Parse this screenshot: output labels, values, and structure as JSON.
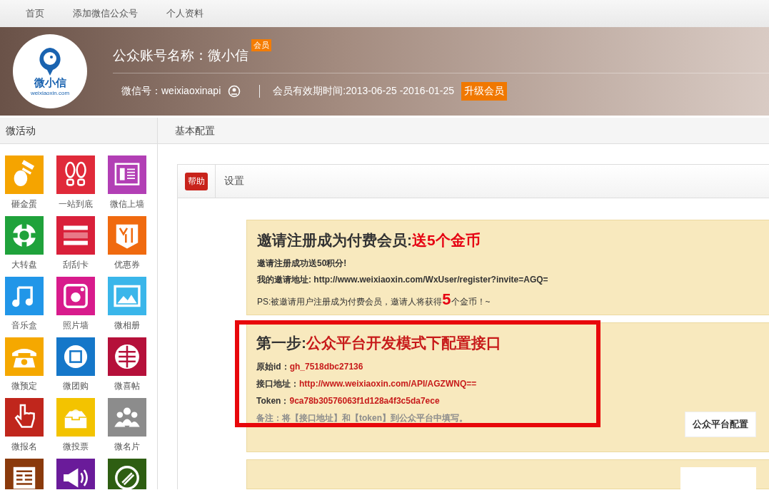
{
  "nav": [
    {
      "label": "首页"
    },
    {
      "label": "添加微信公众号"
    },
    {
      "label": "个人资料"
    }
  ],
  "header": {
    "logo_text": "微小信",
    "logo_domain": "weixiaoxin.com",
    "account_name": "公众账号名称：微小信",
    "badge": "会员",
    "wechat_id": "微信号：weixiaoxinapi",
    "validity": "会员有效期时间:2013-06-25 -2016-01-25",
    "upgrade_button": "升级会员"
  },
  "sidebar": {
    "title": "微活动",
    "tiles": [
      {
        "label": "砸金蛋",
        "color": "#f5a400"
      },
      {
        "label": "一站到底",
        "color": "#e02a3a"
      },
      {
        "label": "微信上墙",
        "color": "#b23fb5"
      },
      {
        "label": "大转盘",
        "color": "#1fa23b"
      },
      {
        "label": "刮刮卡",
        "color": "#d9203a"
      },
      {
        "label": "优惠券",
        "color": "#f06a0f"
      },
      {
        "label": "音乐盒",
        "color": "#2196e8"
      },
      {
        "label": "照片墙",
        "color": "#d81b8c"
      },
      {
        "label": "微相册",
        "color": "#3ab6ea"
      },
      {
        "label": "微预定",
        "color": "#f5a800"
      },
      {
        "label": "微团购",
        "color": "#1577c9"
      },
      {
        "label": "微喜帖",
        "color": "#b5103a"
      },
      {
        "label": "微报名",
        "color": "#c0261c"
      },
      {
        "label": "微投票",
        "color": "#f3c300"
      },
      {
        "label": "微名片",
        "color": "#8c8c8c"
      },
      {
        "color": "#8a3a0c"
      },
      {
        "color": "#6a1b9a"
      },
      {
        "color": "#2e5e12"
      }
    ]
  },
  "main": {
    "title": "基本配置",
    "panel": {
      "help_badge": "帮助",
      "tab": "设置"
    },
    "invite": {
      "title": "邀请注册成为付费会员:",
      "title_highlight": "送5个金币",
      "line": "邀请注册成功送50积分!",
      "address_label": "我的邀请地址:",
      "address": "http://www.weixiaoxin.com/WxUser/register?invite=AGQ=",
      "ps_before": "PS:被邀请用户注册成为付费会员，邀请人将获得",
      "ps_highlight": "5",
      "ps_after": "个金币！~"
    },
    "step": {
      "highlighted": true,
      "title": "第一步:",
      "title_highlight": "公众平台开发模式下配置接口",
      "fields": [
        {
          "label": "原始id：",
          "value": "gh_7518dbc27136"
        },
        {
          "label": "接口地址：",
          "value": "http://www.weixiaoxin.com/API/AGZWNQ=="
        },
        {
          "label": "Token：",
          "value": "9ca78b30576063f1d128a4f3c5da7ece"
        }
      ],
      "note": "备注：将【接口地址】和【token】到公众平台中填写。",
      "button": "公众平台配置"
    }
  }
}
